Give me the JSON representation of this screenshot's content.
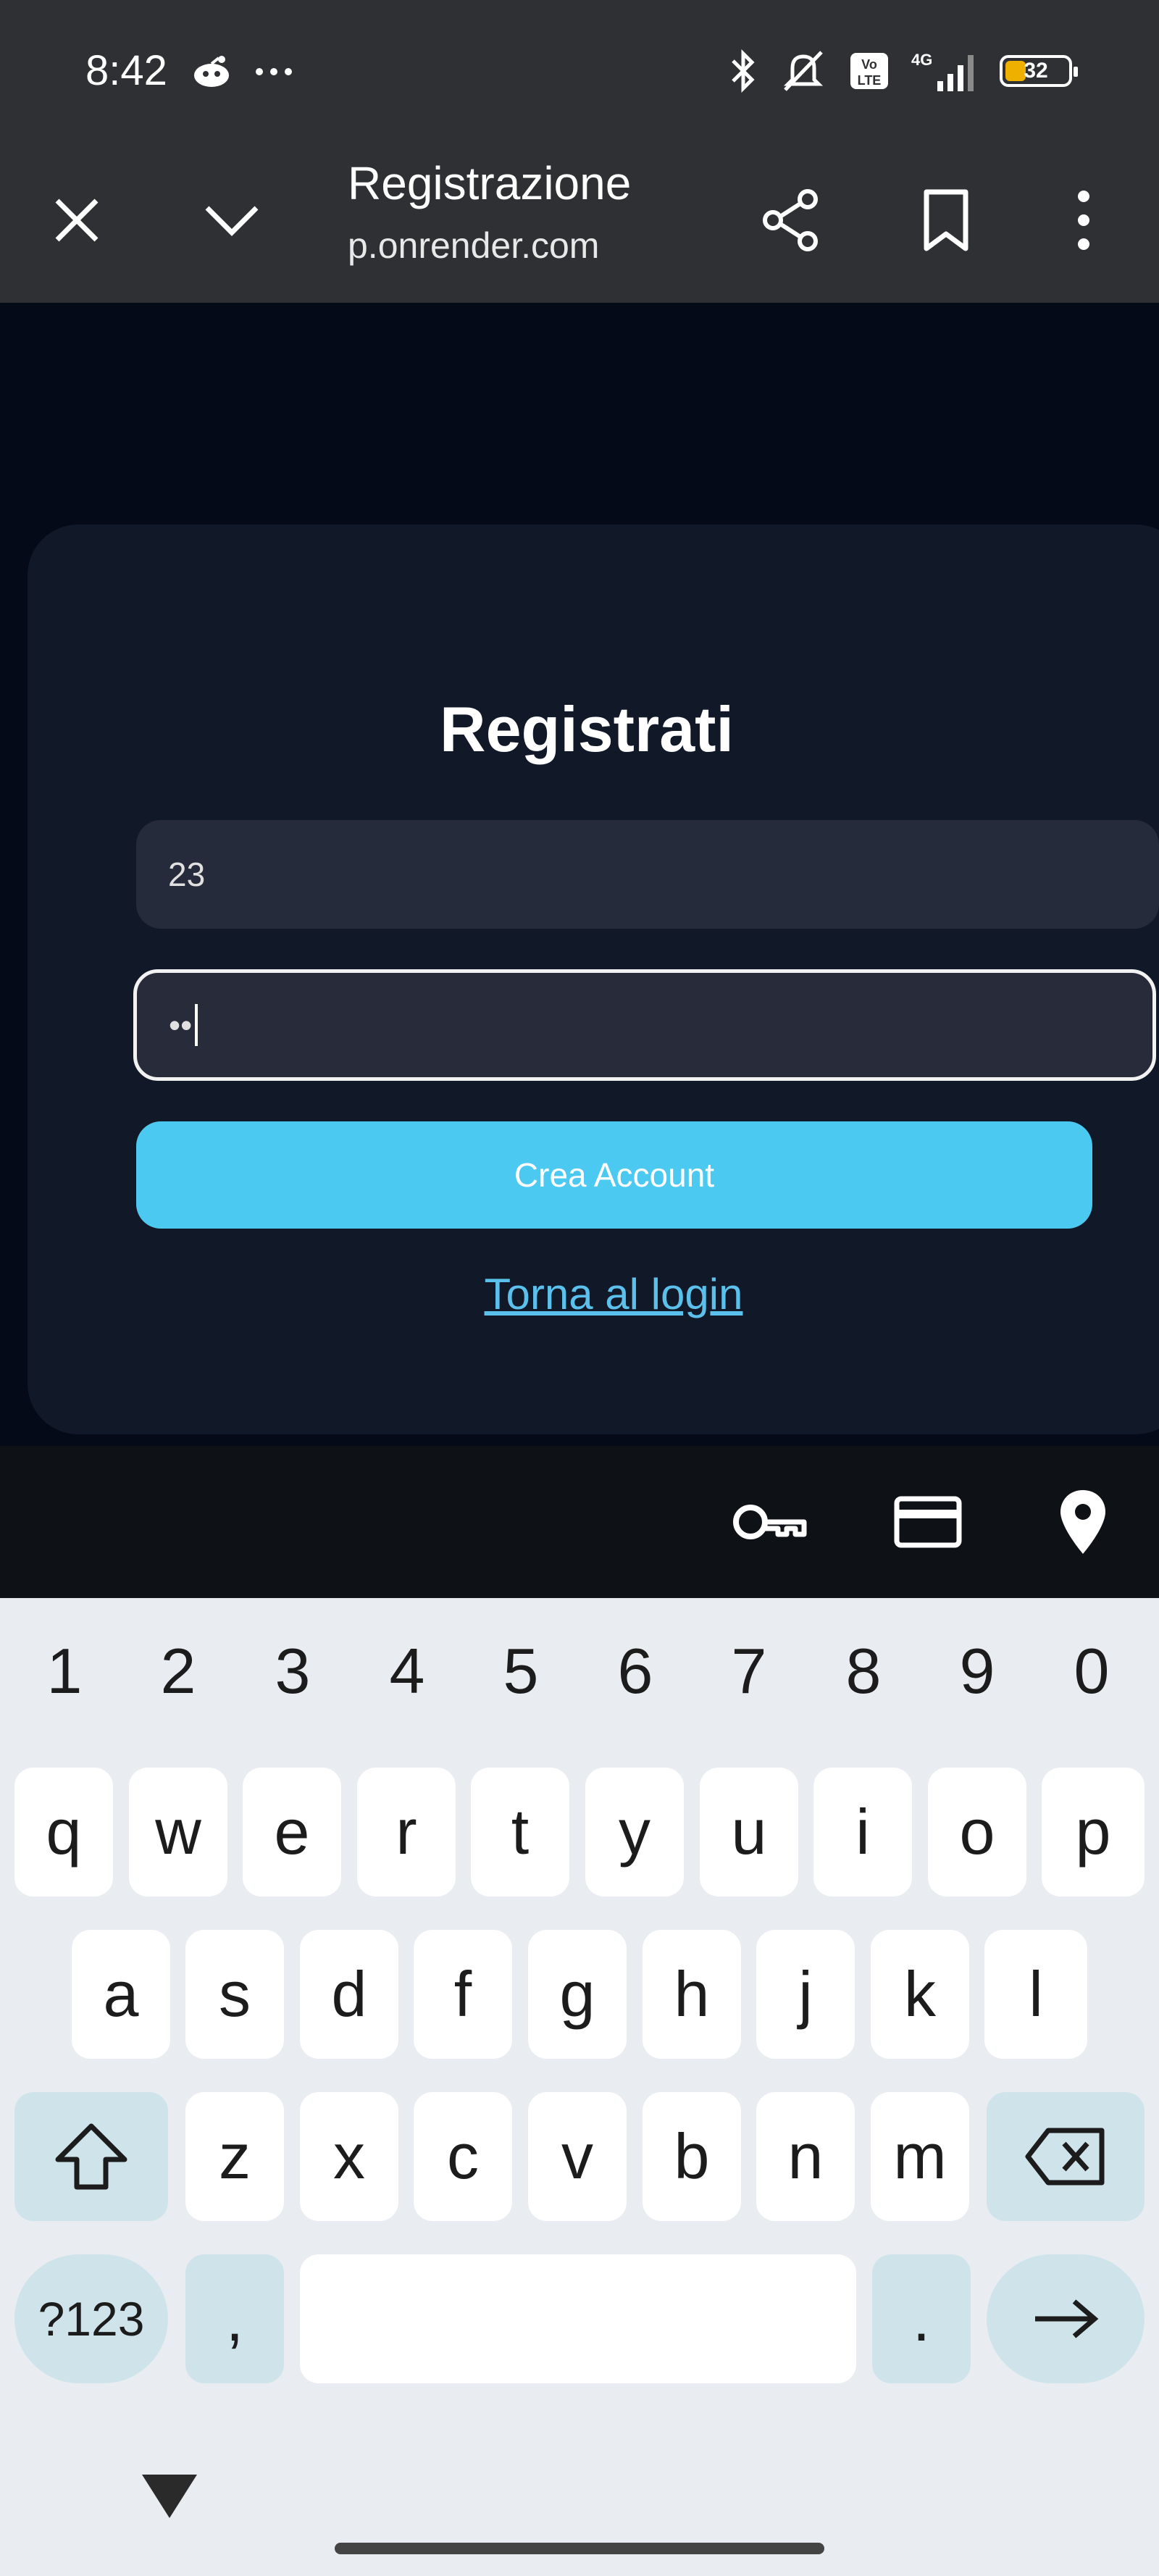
{
  "status_bar": {
    "time": "8:42",
    "left_icons": [
      "reddit-icon",
      "more-dots-icon"
    ],
    "battery_level": "32",
    "right_icons": [
      "bluetooth-icon",
      "silent-icon",
      "volte-icon",
      "signal-4g-icon",
      "battery-icon"
    ]
  },
  "browser": {
    "title": "Registrazione",
    "url": "p.onrender.com"
  },
  "form": {
    "heading": "Registrati",
    "username_value": "23",
    "password_value": "••",
    "submit_label": "Crea Account",
    "login_link": "Torna al login"
  },
  "autofill_icons": [
    "key-icon",
    "credit-card-icon",
    "location-pin-icon"
  ],
  "keyboard": {
    "numbers": [
      "1",
      "2",
      "3",
      "4",
      "5",
      "6",
      "7",
      "8",
      "9",
      "0"
    ],
    "row1": [
      "q",
      "w",
      "e",
      "r",
      "t",
      "y",
      "u",
      "i",
      "o",
      "p"
    ],
    "row2": [
      "a",
      "s",
      "d",
      "f",
      "g",
      "h",
      "j",
      "k",
      "l"
    ],
    "row3": [
      "z",
      "x",
      "c",
      "v",
      "b",
      "n",
      "m"
    ],
    "symbols_label": "?123",
    "comma_label": ",",
    "period_label": "."
  }
}
